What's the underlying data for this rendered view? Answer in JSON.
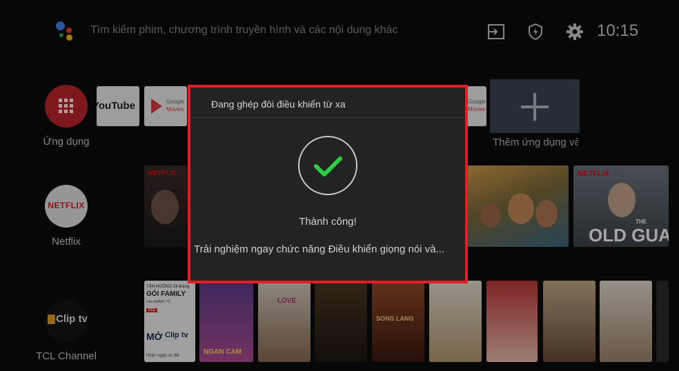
{
  "search": {
    "placeholder": "Tìm kiếm phim, chương trình truyền hình và các nội dung khác"
  },
  "header": {
    "clock": "10:15",
    "icons": [
      "input-source-icon",
      "shield-icon",
      "gear-icon"
    ]
  },
  "sidebar": {
    "items": [
      {
        "label": "Ứng dụng",
        "icon": "apps-grid-icon"
      },
      {
        "label": "Netflix",
        "logo": "NETFLIX"
      },
      {
        "label": "TCL Channel",
        "logo": "Clip tv"
      }
    ]
  },
  "apps_row": {
    "tiles": [
      "YouTube",
      "Google Play Movies & TV",
      "Google Play"
    ],
    "youtube_logo": "YouTube",
    "movies_logo_line1": "Google",
    "movies_logo_line2": "Movies",
    "play_logo_line1": "Google Play",
    "play_logo_line2": "Movies",
    "add_label": "Thêm ứng dụng vào mục ưa thích"
  },
  "netflix_row": {
    "badge": "NETFLIX",
    "old_guard": "OLD GUA",
    "the": "THE"
  },
  "clip_row": {
    "promo_line1": "TẬN HƯỞNG 24 tháng",
    "promo_line2": "GÓI FAMILY",
    "promo_line3": "trên SMART TV",
    "promo_tcl": "TCL",
    "promo_mo": "MỞ",
    "promo_cliptv": "Clip tv",
    "promo_footer": "Nhận ngay ưu đãi",
    "ngan_cam": "NGAN CAM",
    "love": "LOVE",
    "song_lang": "SONG LANG"
  },
  "dialog": {
    "title": "Đang ghép đôi điều khiển từ xa",
    "status": "Thành công!",
    "message": "Trải nghiệm ngay chức năng Điều khiển giọng nói và...",
    "icon": "checkmark-icon",
    "check_color": "#2ecc40",
    "highlight_color": "#e41e26"
  }
}
